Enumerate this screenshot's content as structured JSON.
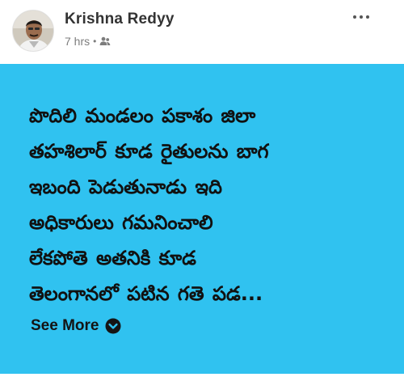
{
  "post": {
    "author_name": "Krishna Redyy",
    "timestamp": "7 hrs",
    "separator": "•",
    "audience_icon": "friends-icon",
    "menu_icon": "more-options-icon",
    "avatar_icon": "profile-photo"
  },
  "content": {
    "background_color": "#30c2f0",
    "text": "పొదిలి మండలం పకాశం జిలా\nతహశిలార్ కూడ రైతులను బాగ\nఇబంది పెడుతునాడు ఇది\nఅధికారులు గమనించాలి\nలేకపోతె అతనికి కూడ\nతెలంగానలో పటిన గతె పడ...",
    "see_more_label": "See More",
    "see_more_icon": "chevron-down-circle-icon"
  }
}
